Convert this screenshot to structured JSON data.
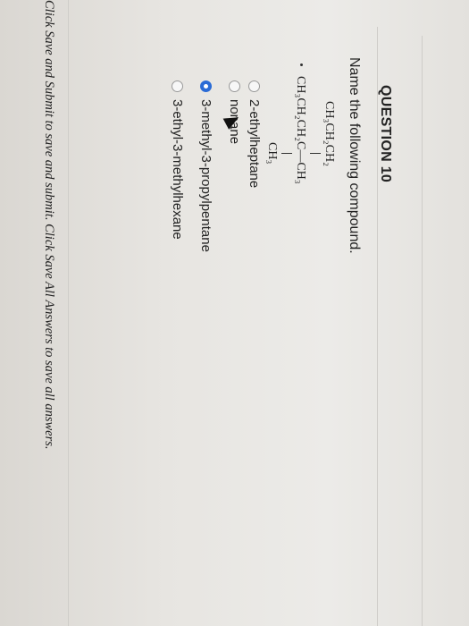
{
  "question": {
    "title": "QUESTION 10",
    "prompt": "Name the following compound.",
    "structure": {
      "top_chain": "CH₃CH₂CH₂",
      "main_chain": "CH₃CH₂CH₂C—CH₃",
      "bottom_sub": "CH₃"
    },
    "options": [
      {
        "label": "2-ethylheptane",
        "selected": false
      },
      {
        "label": "nonane",
        "selected": false
      },
      {
        "label": "3-methyl-3-propylpentane",
        "selected": true
      },
      {
        "label": "3-ethyl-3-methylhexane",
        "selected": false
      }
    ]
  },
  "footer": {
    "instruction": "Click Save and Submit to save and submit. Click Save All Answers to save all answers."
  },
  "colors": {
    "selected_radio": "#2a6bd6"
  }
}
